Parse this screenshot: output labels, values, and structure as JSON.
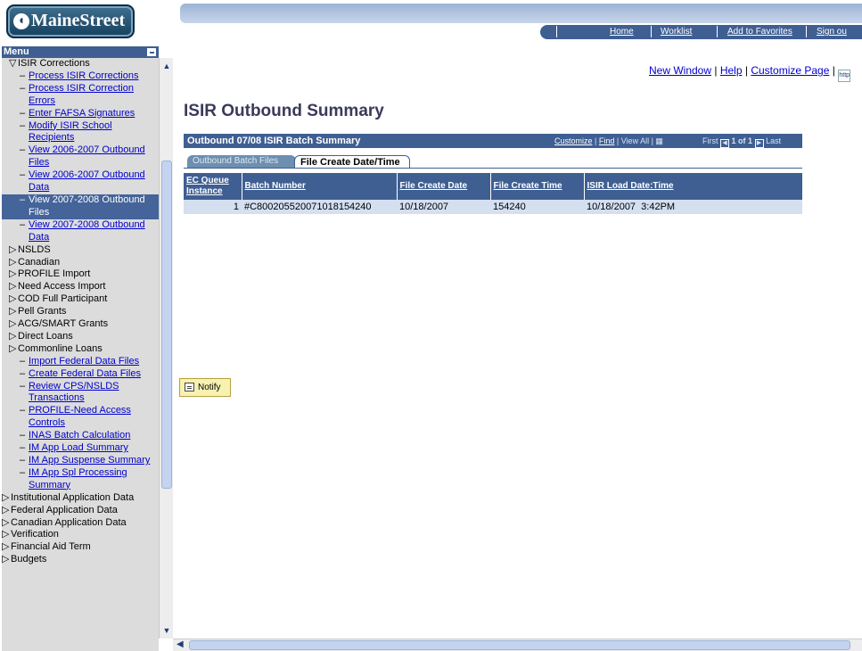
{
  "logo": {
    "text": "MaineStreet"
  },
  "nav": {
    "home": "Home",
    "worklist": "Worklist",
    "favorites": "Add to Favorites",
    "signout": "Sign ou"
  },
  "menu": {
    "title": "Menu",
    "items": [
      {
        "lead": "▽",
        "label": "ISIR Corrections",
        "link": false,
        "indent": 18
      },
      {
        "lead": "–",
        "label": "Process ISIR Corrections",
        "link": true,
        "indent": 30
      },
      {
        "lead": "–",
        "label": "Process ISIR Correction Errors",
        "link": true,
        "indent": 30
      },
      {
        "lead": "–",
        "label": "Enter FAFSA Signatures",
        "link": true,
        "indent": 30
      },
      {
        "lead": "–",
        "label": "Modify ISIR School Recipients",
        "link": true,
        "indent": 30
      },
      {
        "lead": "–",
        "label": "View 2006-2007 Outbound Files",
        "link": true,
        "indent": 30
      },
      {
        "lead": "–",
        "label": "View 2006-2007 Outbound Data",
        "link": true,
        "indent": 30
      },
      {
        "lead": "–",
        "label": "View 2007-2008 Outbound Files",
        "link": false,
        "indent": 30,
        "active": true
      },
      {
        "lead": "–",
        "label": "View 2007-2008 Outbound Data",
        "link": true,
        "indent": 30
      },
      {
        "lead": "▷",
        "label": "NSLDS",
        "link": false,
        "indent": 18
      },
      {
        "lead": "▷",
        "label": "Canadian",
        "link": false,
        "indent": 18
      },
      {
        "lead": "▷",
        "label": "PROFILE Import",
        "link": false,
        "indent": 18
      },
      {
        "lead": "▷",
        "label": "Need Access Import",
        "link": false,
        "indent": 18
      },
      {
        "lead": "▷",
        "label": "COD Full Participant",
        "link": false,
        "indent": 18
      },
      {
        "lead": "▷",
        "label": "Pell Grants",
        "link": false,
        "indent": 18
      },
      {
        "lead": "▷",
        "label": "ACG/SMART Grants",
        "link": false,
        "indent": 18
      },
      {
        "lead": "▷",
        "label": "Direct Loans",
        "link": false,
        "indent": 18
      },
      {
        "lead": "▷",
        "label": "Commonline Loans",
        "link": false,
        "indent": 18
      },
      {
        "lead": "–",
        "label": "Import Federal Data Files",
        "link": true,
        "indent": 30
      },
      {
        "lead": "–",
        "label": "Create Federal Data Files",
        "link": true,
        "indent": 30
      },
      {
        "lead": "–",
        "label": "Review CPS/NSLDS Transactions",
        "link": true,
        "indent": 30
      },
      {
        "lead": "–",
        "label": "PROFILE-Need Access Controls",
        "link": true,
        "indent": 30
      },
      {
        "lead": "–",
        "label": "INAS Batch Calculation",
        "link": true,
        "indent": 30
      },
      {
        "lead": "–",
        "label": "IM App Load Summary",
        "link": true,
        "indent": 30
      },
      {
        "lead": "–",
        "label": "IM App Suspense Summary",
        "link": true,
        "indent": 30
      },
      {
        "lead": "–",
        "label": "IM App Spl Processing Summary",
        "link": true,
        "indent": 30
      },
      {
        "lead": "▷",
        "label": "Institutional Application Data",
        "link": false,
        "indent": 10
      },
      {
        "lead": "▷",
        "label": "Federal Application Data",
        "link": false,
        "indent": 10
      },
      {
        "lead": "▷",
        "label": "Canadian Application Data",
        "link": false,
        "indent": 10
      },
      {
        "lead": "▷",
        "label": "Verification",
        "link": false,
        "indent": 10
      },
      {
        "lead": "▷",
        "label": "Financial Aid Term",
        "link": false,
        "indent": 10
      },
      {
        "lead": "▷",
        "label": "Budgets",
        "link": false,
        "indent": 10
      }
    ]
  },
  "toplinks": {
    "new_window": "New Window",
    "help": "Help",
    "customize": "Customize Page",
    "http": "http"
  },
  "page": {
    "title": "ISIR Outbound Summary"
  },
  "grid": {
    "title": "Outbound 07/08 ISIR Batch Summary",
    "customize": "Customize",
    "find": "Find",
    "view_all": "View All",
    "first": "First",
    "range": "1 of 1",
    "last": "Last",
    "tabs": [
      "Outbound Batch Files",
      "File Create Date/Time"
    ],
    "columns": [
      "EC Queue Instance",
      "Batch Number",
      "File Create Date",
      "File Create Time",
      "ISIR Load Date:Time"
    ],
    "rows": [
      [
        "1",
        "#C800205520071018154240",
        "10/18/2007",
        "154240",
        "10/18/2007  3:42PM"
      ]
    ]
  },
  "notify": {
    "label": "Notify"
  }
}
